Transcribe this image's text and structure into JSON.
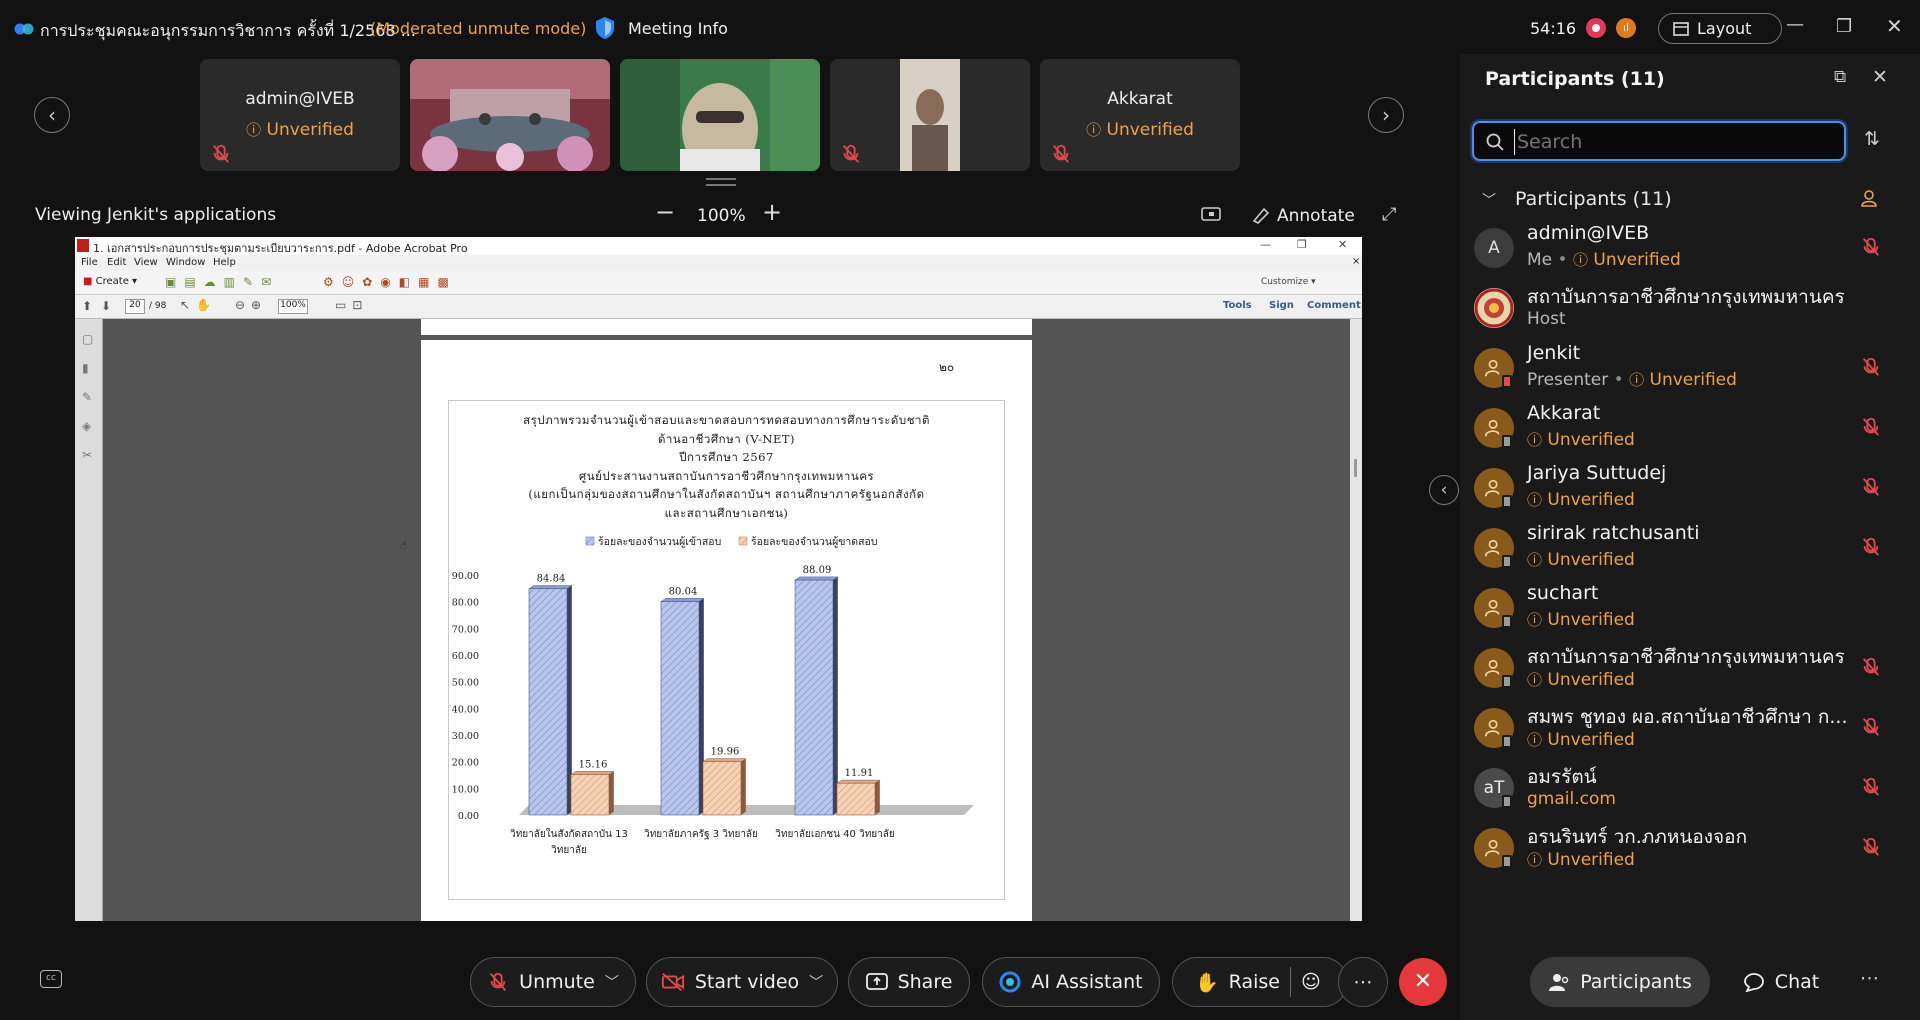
{
  "titlebar": {
    "meeting_title": "การประชุมคณะอนุกรรมการวิชาการ ครั้งที่ 1/2568 ...",
    "mode": "(Moderated unmute mode)",
    "meeting_info": "Meeting Info",
    "timer": "54:16",
    "layout_label": "Layout"
  },
  "thumbnails": [
    {
      "name": "admin@IVEB",
      "status": "Unverified"
    },
    {
      "name": "",
      "status": ""
    },
    {
      "name": "",
      "status": ""
    },
    {
      "name": "",
      "status": ""
    },
    {
      "name": "Akkarat",
      "status": "Unverified"
    }
  ],
  "share": {
    "viewing": "Viewing Jenkit's applications",
    "zoom": "100%",
    "annotate": "Annotate"
  },
  "acrobat": {
    "title": "1. เอกสารประกอบการประชุมตามระเบียบวาระการ.pdf - Adobe Acrobat Pro",
    "menu": [
      "File",
      "Edit",
      "View",
      "Window",
      "Help"
    ],
    "create": "Create",
    "page_num": "20",
    "page_total": "/ 98",
    "zoom": "100%",
    "customize": "Customize",
    "tools": "Tools",
    "sign": "Sign",
    "comment": "Comment",
    "page_number_thai": "๒๐"
  },
  "chart_data": {
    "type": "bar",
    "title_lines": [
      "สรุปภาพรวมจำนวนผู้เข้าสอบและขาดสอบการทดสอบทางการศึกษาระดับชาติ",
      "ด้านอาชีวศึกษา (V-NET)",
      "ปีการศึกษา 2567",
      "ศูนย์ประสานงานสถาบันการอาชีวศึกษากรุงเทพมหานคร",
      "(แยกเป็นกลุ่มของสถานศึกษาในสังกัดสถาบันฯ สถานศึกษาภาครัฐนอกสังกัด",
      "และสถานศึกษาเอกชน)"
    ],
    "categories": [
      [
        "วิทยาลัยในสังกัดสถาบัน 13",
        "วิทยาลัย"
      ],
      [
        "วิทยาลัยภาครัฐ 3 วิทยาลัย"
      ],
      [
        "วิทยาลัยเอกชน 40 วิทยาลัย"
      ]
    ],
    "series": [
      {
        "name": "ร้อยละของจำนวนผู้เข้าสอบ",
        "values": [
          84.84,
          80.04,
          88.09
        ],
        "color": "#b8c6ec"
      },
      {
        "name": "ร้อยละของจำนวนผู้ขาดสอบ",
        "values": [
          15.16,
          19.96,
          11.91
        ],
        "color": "#f6d2b4"
      }
    ],
    "value_labels": [
      [
        "84.84",
        "80.04",
        "88.09"
      ],
      [
        "15.16",
        "19.96",
        "11.91"
      ]
    ],
    "y_ticks": [
      "0.00",
      "10.00",
      "20.00",
      "30.00",
      "40.00",
      "50.00",
      "60.00",
      "70.00",
      "80.00",
      "90.00"
    ],
    "ylim": [
      0,
      90
    ],
    "legend": "top"
  },
  "panel": {
    "title": "Participants (11)",
    "search_placeholder": "Search",
    "section": "Participants (11)",
    "participants": [
      {
        "name": "admin@IVEB",
        "sub1": "Me",
        "sub2": "Unverified",
        "avatar": "A",
        "muted": true
      },
      {
        "name": "สถาบันการอาชีวศึกษากรุงเทพมหานคร",
        "sub1": "Host",
        "sub2": "",
        "avatar": "",
        "muted": false
      },
      {
        "name": "Jenkit",
        "sub1": "Presenter",
        "sub2": "Unverified",
        "avatar": "",
        "muted": true
      },
      {
        "name": "Akkarat",
        "sub1": "",
        "sub2": "Unverified",
        "avatar": "",
        "muted": true
      },
      {
        "name": "Jariya Suttudej",
        "sub1": "",
        "sub2": "Unverified",
        "avatar": "",
        "muted": true
      },
      {
        "name": "sirirak ratchusanti",
        "sub1": "",
        "sub2": "Unverified",
        "avatar": "",
        "muted": true
      },
      {
        "name": "suchart",
        "sub1": "",
        "sub2": "Unverified",
        "avatar": "",
        "muted": false
      },
      {
        "name": "สถาบันการอาชีวศึกษากรุงเทพมหานคร",
        "sub1": "",
        "sub2": "Unverified",
        "avatar": "",
        "muted": true
      },
      {
        "name": "สมพร ชูทอง ผอ.สถาบันอาชีวศึกษา ก...",
        "sub1": "",
        "sub2": "Unverified",
        "avatar": "",
        "muted": true
      },
      {
        "name": "อมรรัตน์",
        "sub1": "gmail.com",
        "sub2": "",
        "avatar": "aT",
        "muted": true
      },
      {
        "name": "อรนรินทร์ วก.ภภหนองจอก",
        "sub1": "",
        "sub2": "Unverified",
        "avatar": "",
        "muted": true
      }
    ]
  },
  "controls": {
    "unmute": "Unmute",
    "start_video": "Start video",
    "share": "Share",
    "ai_assistant": "AI Assistant",
    "raise": "Raise",
    "participants": "Participants",
    "chat": "Chat"
  }
}
